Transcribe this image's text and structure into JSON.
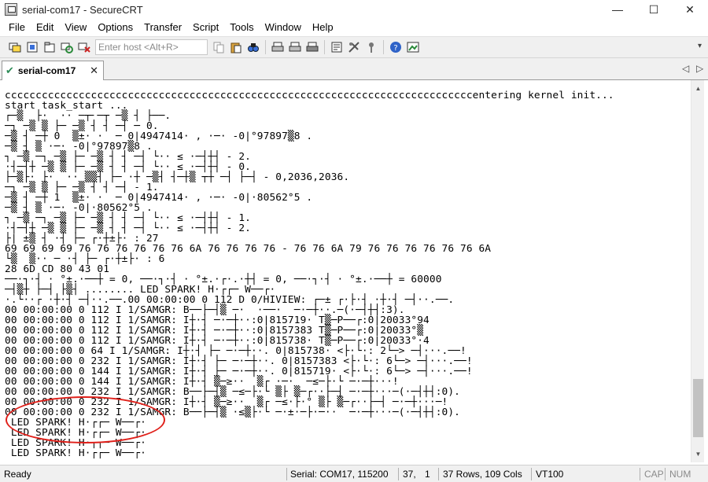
{
  "window": {
    "title": "serial-com17 - SecureCRT",
    "controls": [
      "—",
      "☐",
      "✕"
    ]
  },
  "menu": [
    "File",
    "Edit",
    "View",
    "Options",
    "Transfer",
    "Script",
    "Tools",
    "Window",
    "Help"
  ],
  "toolbar": {
    "host_placeholder": "Enter host <Alt+R>",
    "overflow": "▾"
  },
  "tab": {
    "check": "✔",
    "label": "serial-com17",
    "close": "✕",
    "nav_left": "◁",
    "nav_right": "▷"
  },
  "terminal": {
    "lines": [
      "ccccccccccccccccccccccccccccccccccccccccccccccccccccccccccccccccccccccccccccentering kernel init...",
      "start task_start ...",
      "┌─▒  ├·  ·· ─┬╴─┬ ─▒ ┤ ├──.",
      "─┐ ─▒ ▒ ├─ ─▒ ┤ ┤ ─┤ ─ 0.",
      "─▒ ┤ ─┼ 0  ▒±· ·  ─ 0|4947414· , ·─· -0|°97897▒8 .",
      "─▒ ┤ ▒ ·─· -0|°97897▒8 .",
      "┐ ─▒ ─┐ ─▒ ├─ ─▒ ┤ ┤ ─┤ └·· ≤ ·─┤┼┤ - 2.",
      "·┤─┤┼ ─▒ ▒ ├─ ─▒ ┤ ┤ ─┤ └·· ≤ ·─┤┼┤ - 0.",
      "├─▒├· ├·  ·· ▒▒┤ ├─ ·┼ ─▒┤ ┤─┼▒ ┬┼ ─┤ ├─┤ - 0,2036,2036.",
      "─┐ ─▒ ▒ ├─ ─▒ ┤ ┤ ─┤ - 1.",
      "─▒ ┤ ─┼ 1  ▒±· ·  ─ 0|4947414· , ·─· -0|·80562°5 .",
      "─▒ ┤ ▒ ·─· -0|·80562°5 .",
      "┐ ─▒ ─┐ ─▒ ├─ ─▒ ┤ ┤ ─┤ └·· ≤ ·─┤┼┤ - 1.",
      "·┤─┤┼ ─▒ ▒ ├─ ─▒ ┤ ┤ ─┤ └·· ≤ ·─┤┼┤ - 2.",
      "├| ±▒ ┤ ·┤ ├─ ┌·┼±├· : 27",
      "69 69 69 69 76 76 76 76 76 76 6A 76 76 76 76 - 76 76 6A 79 76 76 76 76 76 76 6A",
      "└▒  ▒·· ─ ·┤ ├─ ┌·┼±├· : 6",
      "28 6D CD 80 43 01",
      "──·┐·┤ · °±.·──┼ = 0, ──·┐·┤ · °±.·┌·.·┼┤ = 0, ──·┐·┤ · °±.·──┼ = 60000",
      "─┤▒┼ ├─┤ ├▒┤ ........ LED SPARK! H·┌┌─ W──┌·",
      "·.└··┌ ·┼·┤ ─┤··.──.00 00:00:00 0 112 D 0/HIVIEW: ┌─± ┌·├·┤ ·┼·┤ ─┤··.──.",
      "00 00:00:00 0 112 I 1/SAMGR: B──├─┤▒ ─·  ·──·  ─·─┼··.─(·─┤┼┤:3).",
      "00 00:00:00 0 112 I 1/SAMGR: I┼·┤ ─·─┼··:0|815719· T▒─P──┌:0|20033°94",
      "00 00:00:00 0 112 I 1/SAMGR: I┼·┤ ─·─┼··:0|8157383 T▒─P──┌:0|20033°▒",
      "00 00:00:00 0 112 I 1/SAMGR: I┼·┤ ─·─┼··:0|815738· T▒─P──┌:0|20033°·4",
      "00 00:00:00 0 64 I 1/SAMGR: I┼·┤ ├─ ─·─┼··. 0|815738· <├·└·: 2└─> ─┤···.──!",
      "00 00:00:00 0 232 I 1/SAMGR: I┼·┤ ├─ ─·─┼··. 0|8157383 <├·└·: 6└─> ─┤···.──!",
      "00 00:00:00 0 144 I 1/SAMGR: I┼·┤ ├─ ─·─┼··. 0|815719· <├·└·: 6└─> ─┤···.──!",
      "00 00:00:00 0 144 I 1/SAMGR: I┼·┤ ▒─≥··  ▒┌ ·─·  ─≤─├·└ ─·─┼···!",
      "00 00:00:00 0 232 I 1/SAMGR: B──├─┤▒ ─≤─├·└ ▒├ ▒─┌··├─┤ ─·─┼···─(·─┤┼┤:0).",
      "00 00:00:00 0 232 I 1/SAMGR: I┼·┤ ▒─≥··  ▒┌ ─≤·├·° ▒├ ▒─┌··├─┤ ─·─┼···─!",
      "00 00:00:00 0 232 I 1/SAMGR: B──├─┤▒ ·≤▒├·└ ─·±·─├·─··  ─·─┼···─(·─┤┼┤:0).",
      " LED SPARK! H·┌┌─ W──┌·",
      " LED SPARK! H·┌┌─ W──┌·",
      " LED SPARK! H·┌┌─ W──┌·",
      " LED SPARK! H·┌┌─ W──┌·"
    ]
  },
  "scrollbar": {
    "up": "▲",
    "down": "▼"
  },
  "status": {
    "ready": "Ready",
    "connection": "Serial: COM17, 115200",
    "row": "37,",
    "col": "1",
    "size": "37 Rows, 109 Cols",
    "emulation": "VT100",
    "cap": "CAP",
    "num": "NUM"
  },
  "colors": {
    "annotation": "#e0201a",
    "tab_check": "#2e8b57"
  }
}
